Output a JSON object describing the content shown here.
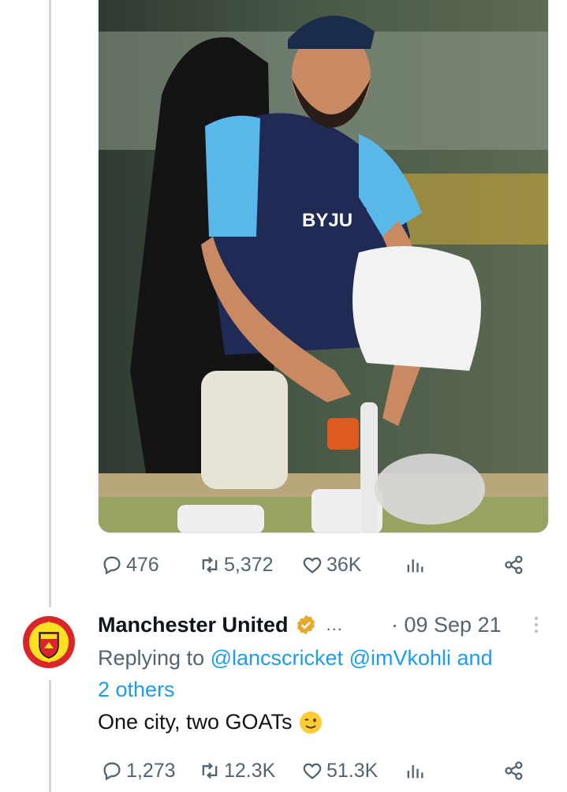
{
  "tweet": {
    "image_icon": "photo-cricketer",
    "actions": {
      "replies": "476",
      "retweets": "5,372",
      "likes": "36K"
    }
  },
  "reply": {
    "author_name": "Manchester United",
    "ellipsis": "...",
    "date": "· 09 Sep 21",
    "replying_prefix": "Replying to",
    "mention_1": "@lancscricket",
    "mention_2": "@imVkohli",
    "and_text": "and",
    "others_text": "2 others",
    "text": "One city, two GOATs",
    "emoji": "wink-emoji",
    "actions": {
      "replies": "1,273",
      "retweets": "12.3K",
      "likes": "51.3K"
    }
  },
  "colors": {
    "link": "#1d9bf0",
    "secondary_text": "#536471",
    "thread_line": "#cfd9de",
    "verified_badge": "#e8a92a"
  }
}
